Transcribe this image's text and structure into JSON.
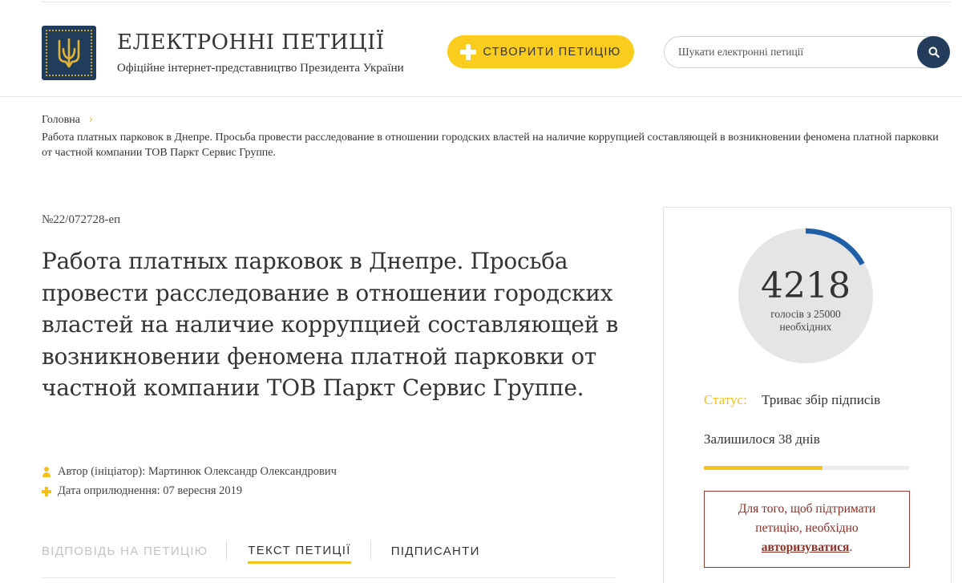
{
  "header": {
    "title": "ЕЛЕКТРОННІ ПЕТИЦІЇ",
    "subtitle": "Офіційне інтернет-представництво Президента України",
    "create_button": "СТВОРИТИ ПЕТИЦІЮ",
    "search_placeholder": "Шукати електронні петиції"
  },
  "breadcrumb": {
    "home": "Головна",
    "separator": "›",
    "current": "Работа платных парковок в Днепре. Просьба провести расследование в отношении городских властей на наличие коррупцией составляющей в возникновении феномена платной парковки от частной компании ТОВ Паркт Сервис Группе."
  },
  "petition": {
    "number": "№22/072728-еп",
    "title": "Работа платных парковок в Днепре. Просьба провести расследование в отношении городских властей на наличие коррупцией составляющей в возникновении феномена платной парковки от частной компании ТОВ Паркт Сервис Группе.",
    "author": "Автор (ініціатор): Мартинюк Олександр Олександрович",
    "date": "Дата оприлюднення: 07 вересня 2019"
  },
  "tabs": {
    "answer": "ВІДПОВІДЬ НА ПЕТИЦІЮ",
    "text": "ТЕКСТ ПЕТИЦІЇ",
    "signers": "ПІДПИСАНТИ"
  },
  "sidebar": {
    "votes": "4218",
    "votes_label": "голосів з 25000 необхідних",
    "votes_progress": 0.1687,
    "status_label": "Статус:",
    "status_value": "Триває збір підписів",
    "remaining": "Залишилося 38 днів",
    "days_progress": 0.58,
    "auth_before": "Для того, щоб підтримати петицію, необхідно",
    "auth_link": "авторизуватися",
    "auth_after": "."
  },
  "colors": {
    "accent_yellow": "#f9cc1e",
    "navy": "#243d5d",
    "ring_blue": "#1f5fa8",
    "auth_red": "#8c2f26"
  }
}
